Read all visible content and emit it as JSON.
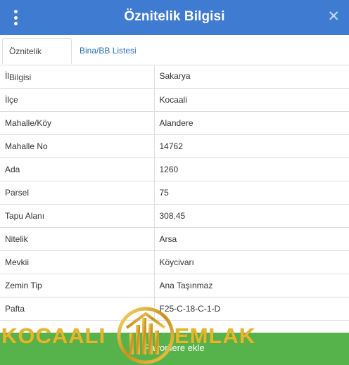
{
  "header": {
    "title": "Öznitelik Bilgisi",
    "menu_icon": "vertical-dots-icon",
    "close_icon": "close-icon",
    "color": "#3f7bd0"
  },
  "tabs": [
    {
      "label": "Öznitelik Bilgisi",
      "active": true
    },
    {
      "label": "Bina/BB Listesi",
      "active": false
    }
  ],
  "attributes": [
    {
      "key": "İl",
      "value": "Sakarya"
    },
    {
      "key": "İlçe",
      "value": "Kocaali"
    },
    {
      "key": "Mahalle/Köy",
      "value": "Alandere"
    },
    {
      "key": "Mahalle No",
      "value": "14762"
    },
    {
      "key": "Ada",
      "value": "1260"
    },
    {
      "key": "Parsel",
      "value": "75"
    },
    {
      "key": "Tapu Alanı",
      "value": "308,45"
    },
    {
      "key": "Nitelik",
      "value": "Arsa"
    },
    {
      "key": "Mevkii",
      "value": "Köycivarı"
    },
    {
      "key": "Zemin Tip",
      "value": "Ana Taşınmaz"
    },
    {
      "key": "Pafta",
      "value": "F25-C-18-C-1-D"
    }
  ],
  "footer": {
    "label": "Favorilere ekle",
    "color": "#56b24b"
  },
  "watermark": {
    "left_text": "KOCAALI",
    "right_text": "EMLAK",
    "color": "#e3b72b"
  }
}
